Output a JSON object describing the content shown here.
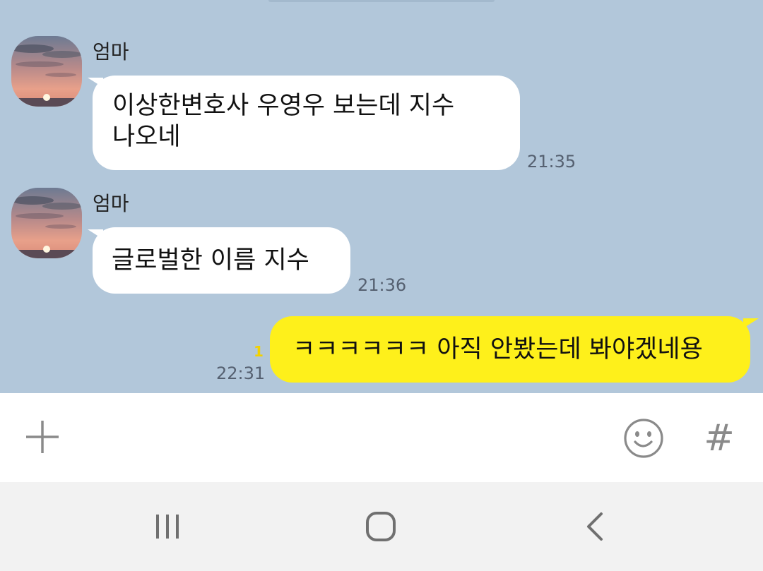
{
  "chat": {
    "messages": [
      {
        "sender": "엄마",
        "text_line1": "이상한변호사  우영우 보는데  지수",
        "text_line2": "나오네",
        "time": "21:35"
      },
      {
        "sender": "엄마",
        "text": "글로벌한 이름 지수",
        "time": "21:36"
      },
      {
        "text": "ㅋㅋㅋㅋㅋㅋ 아직 안봤는데 봐야겠네용",
        "time": "22:31",
        "unread_count": "1"
      }
    ]
  },
  "input_bar": {
    "add_icon": "plus-icon",
    "emoji_icon": "smiley-icon",
    "hash_label": "#"
  },
  "nav_bar": {
    "recents_icon": "recent-apps-icon",
    "home_icon": "home-icon",
    "back_icon": "back-icon"
  },
  "colors": {
    "chat_background": "#b2c7da",
    "incoming_bubble": "#ffffff",
    "outgoing_bubble": "#fef01b",
    "unread_badge": "#f2d100"
  }
}
